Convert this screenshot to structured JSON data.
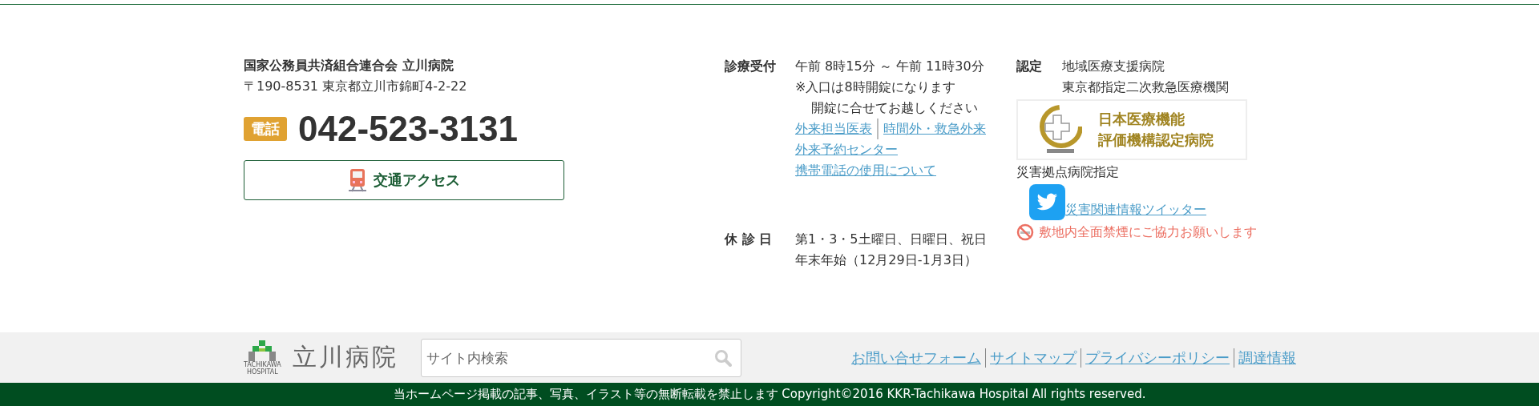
{
  "org": {
    "name": "国家公務員共済組合連合会 立川病院",
    "address": "〒190-8531 東京都立川市錦町4-2-22",
    "phone_label": "電話",
    "phone": "042-523-3131",
    "access_button": "交通アクセス"
  },
  "reception": {
    "label": "診療受付",
    "hours": "午前 8時15分 ～ 午前 11時30分",
    "notes": [
      "※入口は8時開錠になります",
      "開錠に合せてお越しください"
    ],
    "link_rows": [
      [
        "外来担当医表",
        "時間外・救急外来"
      ],
      [
        "外来予約センター"
      ],
      [
        "携帯電話の使用について"
      ]
    ]
  },
  "closed": {
    "label": "休 診 日",
    "lines": [
      "第1・3・5土曜日、日曜日、祝日",
      "年末年始（12月29日-1月3日）"
    ]
  },
  "certification": {
    "label": "認定",
    "lines": [
      "地域医療支援病院",
      "東京都指定二次救急医療機関"
    ],
    "badge_lines": [
      "日本医療機能",
      "評価機構認定病院"
    ],
    "disaster": "災害拠点病院指定",
    "twitter_link": "災害関連情報ツイッター",
    "no_smoking": "敷地内全面禁煙にご協力お願いします"
  },
  "footer": {
    "logo_name": "立川病院",
    "logo_sub": [
      "TACHIKAWA",
      "HOSPITAL"
    ],
    "search": {
      "placeholder": "サイト内検索"
    },
    "links": [
      "お問い合せフォーム",
      "サイトマップ",
      "プライバシーポリシー",
      "調達情報"
    ]
  },
  "copyright": "当ホームページ掲載の記事、写真、イラスト等の無断転載を禁止します Copyright©2016 KKR-Tachikawa Hospital All rights reserved."
}
